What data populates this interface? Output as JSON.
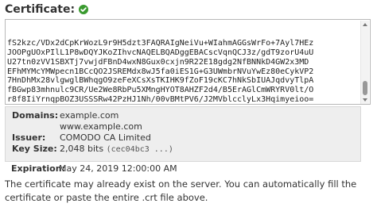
{
  "certificate": {
    "label": "Certificate:",
    "status_icon": "check-circle-icon",
    "status_color": "#3a9a2f",
    "text": "fS2kzc/VDx2dCpKrWozL9r9H5dzt3FAQRAIgNeiVu+WIahmAGGsWrFo+7Ayl7HEz\nJOOPgUOxPIlL1P8wDQYJKoZIhvcNAQELBQADggEBACscVqnQCJ3z/gdT9zorU4uU\nU27tn0zVV1SBXTj7vwjdFBnD4wxN8Gux0cxjn9R22E18gdg2NfBNNkD4GW2x3MD\nEFhMYMcYMWpecn1BCcQO2JSREMdx8wJ5fa0iES1G+G3UWmbrNVuYwEz80eCykVP2\n7HnDhMx28vlgwglBWhqgO9zeFeXCsXsTKIHK9fZoF19cKC7hNkSbIUAJqdvyTlpA\nfBGwp83mhnulc9CR/Ue2We8RbPu5XMngHYOT8AHZF2d4/B5ErAGlCmWRYRV0lt/O\nr8f8IiYrnqpBOZ3USSSRw42PzHJ1Nh/00vBMtPV6/J2MVblcclyLx3Hqimyeioo=\n-----END CERTIFICATE-----"
  },
  "details": {
    "domains_label": "Domains:",
    "domains": [
      "example.com",
      "www.example.com"
    ],
    "issuer_label": "Issuer:",
    "issuer": "COMODO CA Limited",
    "key_size_label": "Key Size:",
    "key_size": "2,048 bits",
    "key_hash": "(cec04bc3 ...)",
    "expiration_label": "Expiration:",
    "expiration": "May 24, 2019 12:00:00 AM"
  },
  "help": {
    "text": "The certificate may already exist on the server. You can automatically fill the certificate or paste the entire .crt file above."
  }
}
